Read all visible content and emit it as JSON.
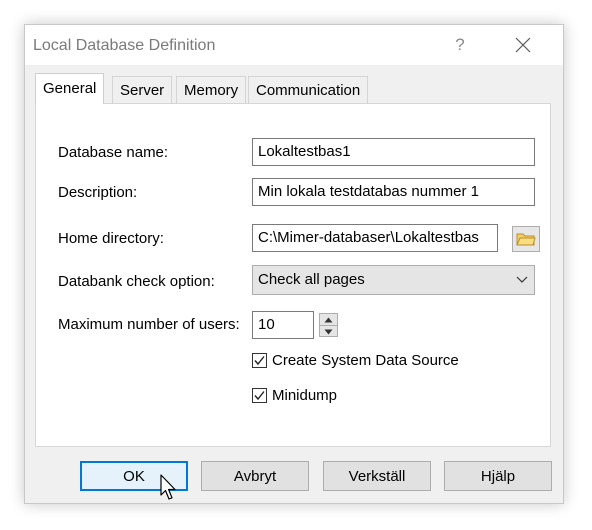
{
  "dialog": {
    "title": "Local Database Definition",
    "help_glyph": "?"
  },
  "tabs": [
    {
      "label": "General",
      "active": true
    },
    {
      "label": "Server"
    },
    {
      "label": "Memory"
    },
    {
      "label": "Communication"
    }
  ],
  "form": {
    "database_name": {
      "label": "Database name:",
      "value": "Lokaltestbas1"
    },
    "description": {
      "label": "Description:",
      "value": "Min lokala testdatabas nummer 1"
    },
    "home_directory": {
      "label": "Home directory:",
      "value": "C:\\Mimer-databaser\\Lokaltestbas"
    },
    "databank_check": {
      "label": "Databank check option:",
      "value": "Check all pages"
    },
    "max_users": {
      "label": "Maximum number of users:",
      "value": "10"
    },
    "create_dsn": {
      "label": "Create System Data Source",
      "checked": true
    },
    "minidump": {
      "label": "Minidump",
      "checked": true
    }
  },
  "buttons": {
    "ok": "OK",
    "cancel": "Avbryt",
    "apply": "Verkställ",
    "help": "Hjälp"
  },
  "colors": {
    "accent": "#0078d7",
    "dialog_bg": "#f0f0f0"
  }
}
